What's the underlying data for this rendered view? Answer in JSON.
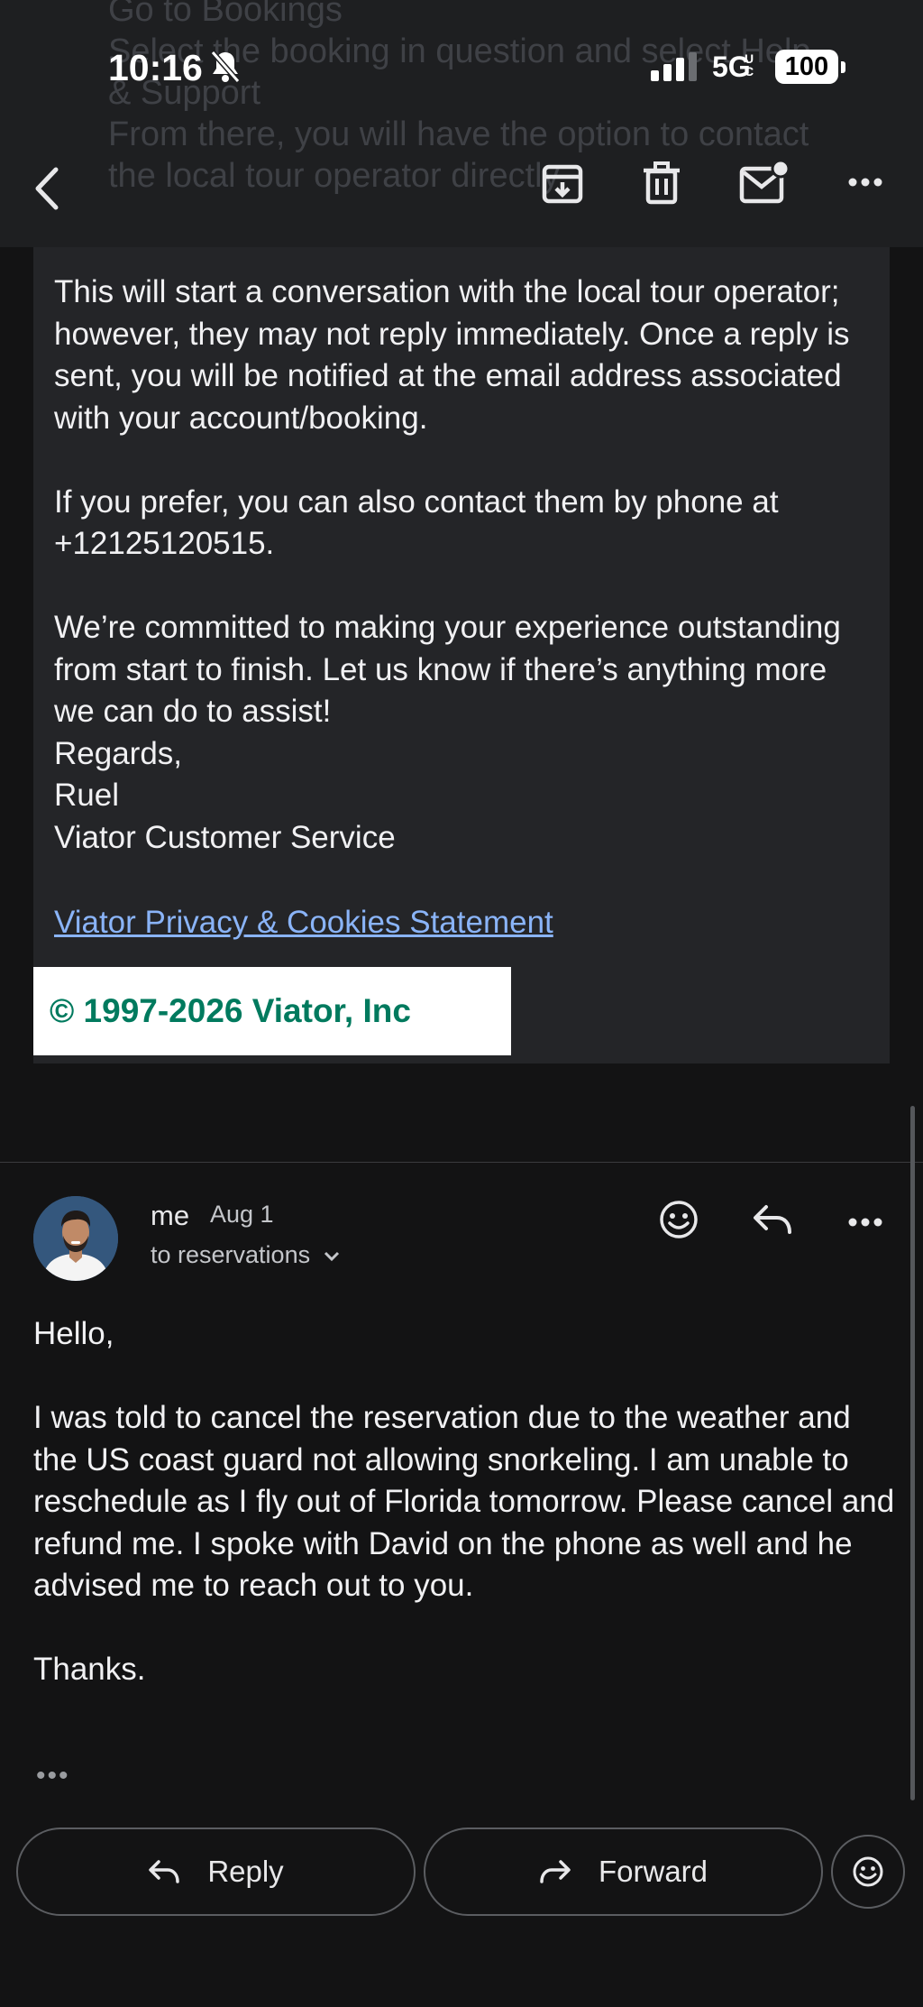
{
  "status_bar": {
    "time": "10:16",
    "network": "5G",
    "network_sub": "UC",
    "battery": "100"
  },
  "background_quote": {
    "lines": [
      "Go to Bookings",
      "Select the booking in question and select Help",
      "& Support",
      "From there, you will have the option to contact",
      "the local tour operator directly"
    ]
  },
  "toolbar": {
    "icons": [
      "back-icon",
      "archive-icon",
      "delete-icon",
      "mark-unread-icon",
      "more-icon"
    ]
  },
  "quoted_message": {
    "paragraph1": "This will start a conversation with the local tour operator; however, they may not reply immediately. Once a reply is sent, you will be notified at the email address associated with your account/booking.",
    "paragraph2_line1": "If you prefer, you can also contact them by phone at",
    "phone": "+12125120515.",
    "paragraph3": "We’re committed to making your experience outstanding from start to finish. Let us know if there’s anything more we can do to assist!",
    "closing": "Regards,",
    "signer": "Ruel",
    "team": "Viator Customer Service",
    "privacy_link": "Viator Privacy & Cookies Statement",
    "copyright": "© 1997-2026 Viator, Inc"
  },
  "reply": {
    "sender": "me",
    "date": "Aug 1",
    "recipients": "to reservations",
    "greeting": "Hello,",
    "body": "I was told to cancel the reservation due to the weather and the US coast guard not allowing snorkeling. I am unable to reschedule as I fly out of Florida tomorrow. Please cancel and refund me. I spoke with David on the phone as well and he advised me to reach out to you.",
    "signoff": "Thanks.",
    "trimmed": "•••"
  },
  "actions": {
    "reply_label": "Reply",
    "forward_label": "Forward"
  },
  "colors": {
    "background": "#131314",
    "card": "#242528",
    "link": "#8ab4f8",
    "copyright_text": "#007a5e"
  }
}
